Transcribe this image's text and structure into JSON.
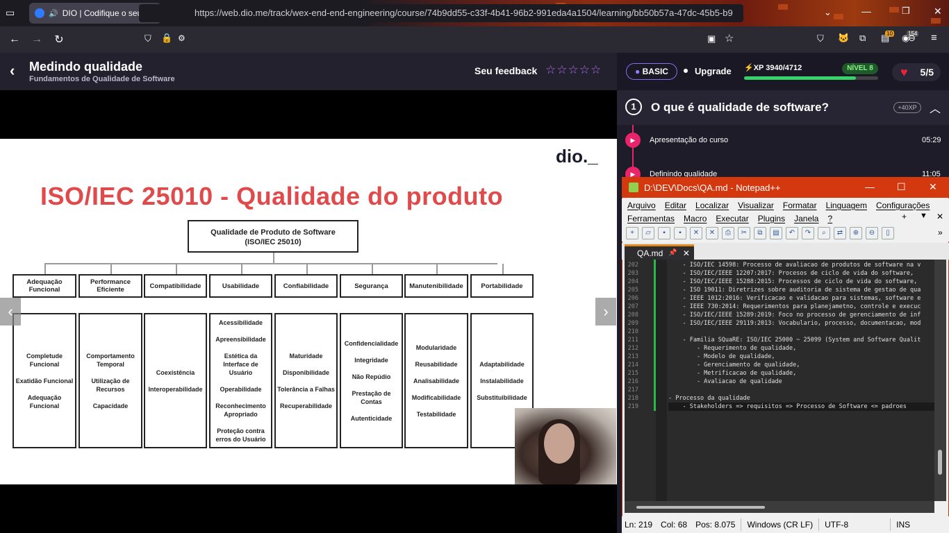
{
  "browser": {
    "tab_title": "DIO | Codifique o seu futuro",
    "url": "https://web.dio.me/track/wex-end-end-engineering/course/74b9dd55-c33f-4b41-96b2-991eda4a1504/learning/bb50b57a-47dc-45b5-b9",
    "extension_badge_1": "10",
    "extension_badge_2": "154"
  },
  "header": {
    "title": "Medindo qualidade",
    "subtitle": "Fundamentos de Qualidade de Software",
    "feedback_label": "Seu feedback",
    "stars": "☆☆☆☆☆",
    "plan_badge": "BASIC",
    "upgrade": "Upgrade",
    "xp_label": "XP 3940/4712",
    "xp_progress": 0.836,
    "level_badge": "NÍVEL 8",
    "lives": "5/5"
  },
  "slide": {
    "title": "ISO/IEC 25010 - Qualidade do produto",
    "logo": "dio._",
    "root_line1": "Qualidade de Produto de Software",
    "root_line2": "(ISO/IEC 25010)",
    "categories": [
      {
        "name": "Adequação Funcional",
        "subs": [
          "Completude Funcional",
          "Exatidão Funcional",
          "Adequação Funcional"
        ]
      },
      {
        "name": "Performance Eficiente",
        "subs": [
          "Comportamento Temporal",
          "Utilização de Recursos",
          "Capacidade"
        ]
      },
      {
        "name": "Compatibilidade",
        "subs": [
          "Coexistência",
          "Interoperabilidade"
        ]
      },
      {
        "name": "Usabilidade",
        "subs": [
          "Acessibilidade",
          "Apreensibilidade",
          "Estética da Interface de Usuário",
          "Operabilidade",
          "Reconhecimento Apropriado",
          "Proteção contra erros do Usuário"
        ]
      },
      {
        "name": "Confiabilidade",
        "subs": [
          "Maturidade",
          "Disponibilidade",
          "Tolerância a Falhas",
          "Recuperabilidade"
        ]
      },
      {
        "name": "Segurança",
        "subs": [
          "Confidencialidade",
          "Integridade",
          "Não Repúdio",
          "Prestação de Contas",
          "Autenticidade"
        ]
      },
      {
        "name": "Manutenibilidade",
        "subs": [
          "Modularidade",
          "Reusabilidade",
          "Analisabilidade",
          "Modificabilidade",
          "Testabilidade"
        ]
      },
      {
        "name": "Portabilidade",
        "subs": [
          "Adaptabilidade",
          "Instalabilidade",
          "Substituibilidade"
        ]
      }
    ]
  },
  "course": {
    "module_number": "1",
    "module_title": "O que é qualidade de software?",
    "module_xp": "+40XP",
    "lessons": [
      {
        "name": "Apresentação do curso",
        "time": "05:29"
      },
      {
        "name": "Definindo qualidade",
        "time": "11:05"
      }
    ]
  },
  "notepad": {
    "title": "D:\\DEV\\Docs\\QA.md - Notepad++",
    "menu1": [
      "Arquivo",
      "Editar",
      "Localizar",
      "Visualizar",
      "Formatar",
      "Linguagem",
      "Configurações"
    ],
    "menu2": [
      "Ferramentas",
      "Macro",
      "Executar",
      "Plugins",
      "Janela",
      "?"
    ],
    "tab_name": "QA.md",
    "lines": [
      {
        "n": "202",
        "text": "    - ISO/IEC 14598: Processo de avaliacao de produtos de software na v"
      },
      {
        "n": "203",
        "text": "    - ISO/IEC/IEEE 12207:2017: Procesos de ciclo de vida do software,"
      },
      {
        "n": "204",
        "text": "    - ISO/IEC/IEEE 15288:2015: Processos de ciclo de vida do software,"
      },
      {
        "n": "205",
        "text": "    - ISO 19011: Diretrizes sobre auditoria de sistema de gestao de qua"
      },
      {
        "n": "206",
        "text": "    - IEEE 1012:2016: Verificacao e validacao para sistemas, software e"
      },
      {
        "n": "207",
        "text": "    - IEEE 730:2014: Requerimentos para planejametno, controle e execuc"
      },
      {
        "n": "208",
        "text": "    - ISO/IEC/IEEE 15289:2019: Foco no processo de gerenciamento de inf"
      },
      {
        "n": "209",
        "text": "    - ISO/IEC/IEEE 29119:2013: Vocabulario, processo, documentacao, mod"
      },
      {
        "n": "210",
        "text": ""
      },
      {
        "n": "211",
        "text": "    - Familia SQuaRE: ISO/IEC 25000 ~ 25099 (System and Software Qualit"
      },
      {
        "n": "212",
        "text": "        - Requerimento de qualidade,"
      },
      {
        "n": "213",
        "text": "        - Modelo de qualidade,"
      },
      {
        "n": "214",
        "text": "        - Gerenciamento de qualidade,"
      },
      {
        "n": "215",
        "text": "        - Metrificacao de qualidade,"
      },
      {
        "n": "216",
        "text": "        - Avaliacao de qualidade"
      },
      {
        "n": "217",
        "text": ""
      },
      {
        "n": "218",
        "text": "- Processo da qualidade"
      },
      {
        "n": "219",
        "text": "    - Stakeholders => requisitos => Processo de Software <= padroes"
      }
    ],
    "status": {
      "ln": "Ln: 219",
      "col": "Col: 68",
      "pos": "Pos: 8.075",
      "eol": "Windows (CR LF)",
      "encoding": "UTF-8",
      "mode": "INS"
    }
  }
}
